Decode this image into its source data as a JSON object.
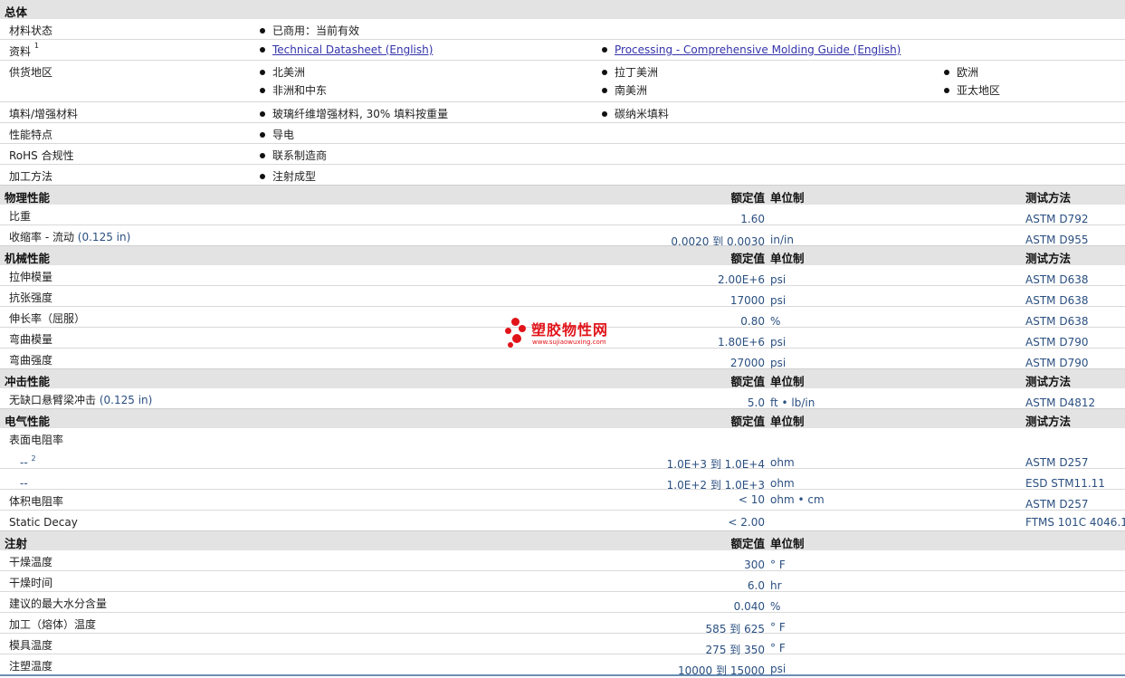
{
  "general": {
    "title": "总体",
    "rows": [
      {
        "label": "材料状态",
        "items": [
          "已商用：当前有效"
        ]
      },
      {
        "label": "资料",
        "sup": "1",
        "links": [
          "Technical Datasheet (English)",
          "Processing - Comprehensive Molding Guide (English)"
        ]
      },
      {
        "label": "供货地区",
        "items": [
          "北美洲",
          "拉丁美洲",
          "欧洲",
          "非洲和中东",
          "南美洲",
          "亚太地区"
        ]
      },
      {
        "label": "填料/增强材料",
        "items": [
          "玻璃纤维增强材料, 30% 填料按重量",
          "碳纳米填料"
        ]
      },
      {
        "label": "性能特点",
        "items": [
          "导电"
        ]
      },
      {
        "label": "RoHS 合规性",
        "items": [
          "联系制造商"
        ]
      },
      {
        "label": "加工方法",
        "items": [
          "注射成型"
        ]
      }
    ]
  },
  "headers": {
    "value": "额定值",
    "unit": "单位制",
    "method": "测试方法"
  },
  "physical": {
    "title": "物理性能",
    "rows": [
      {
        "label": "比重",
        "value": "1.60",
        "unit": "",
        "method": "ASTM D792"
      },
      {
        "label": "收缩率  - 流动",
        "param": "(0.125 in)",
        "value": "0.0020 到  0.0030",
        "unit": "in/in",
        "method": "ASTM D955"
      }
    ]
  },
  "mechanical": {
    "title": "机械性能",
    "rows": [
      {
        "label": "拉伸模量",
        "value": "2.00E+6",
        "unit": "psi",
        "method": "ASTM D638"
      },
      {
        "label": "抗张强度",
        "value": "17000",
        "unit": "psi",
        "method": "ASTM D638"
      },
      {
        "label": "伸长率（屈服）",
        "value": "0.80",
        "unit": "%",
        "method": "ASTM D638"
      },
      {
        "label": "弯曲模量",
        "value": "1.80E+6",
        "unit": "psi",
        "method": "ASTM D790"
      },
      {
        "label": "弯曲强度",
        "value": "27000",
        "unit": "psi",
        "method": "ASTM D790"
      }
    ]
  },
  "impact": {
    "title": "冲击性能",
    "rows": [
      {
        "label": "无缺口悬臂梁冲击",
        "param": "(0.125 in)",
        "value": "5.0",
        "unit": "ft • lb/in",
        "method": "ASTM D4812"
      }
    ]
  },
  "electrical": {
    "title": "电气性能",
    "surface_label": "表面电阻率",
    "sub1": {
      "label": "--",
      "sup": "2",
      "value": "1.0E+3 到  1.0E+4",
      "unit": "ohm",
      "method": "ASTM D257"
    },
    "sub2": {
      "label": "--",
      "value": "1.0E+2 到  1.0E+3",
      "unit": "ohm",
      "method": "ESD STM11.11"
    },
    "volume": {
      "label": "体积电阻率",
      "value": "< 10",
      "unit": "ohm • cm",
      "method": "ASTM D257"
    },
    "static": {
      "label": "Static Decay",
      "value": "< 2.00",
      "unit": "",
      "method": "FTMS 101C 4046.1"
    }
  },
  "injection": {
    "title": "注射",
    "rows": [
      {
        "label": "干燥温度",
        "value": "300",
        "unit": "° F"
      },
      {
        "label": "干燥时间",
        "value": "6.0",
        "unit": "hr"
      },
      {
        "label": "建议的最大水分含量",
        "value": "0.040",
        "unit": "%"
      },
      {
        "label": "加工（熔体）温度",
        "value": "585 到  625",
        "unit": "° F"
      },
      {
        "label": "模具温度",
        "value": "275 到  350",
        "unit": "° F"
      },
      {
        "label": "注塑温度",
        "value": "10000 到  15000",
        "unit": "psi"
      }
    ]
  },
  "watermark": {
    "cn": "塑胶物性网",
    "en": "www.sujiaowuxing.com"
  },
  "colors": {
    "section_bg": "#e3e3e3",
    "value_text": "#2a4f80",
    "link": "#3333aa",
    "watermark": "#e1141a"
  }
}
